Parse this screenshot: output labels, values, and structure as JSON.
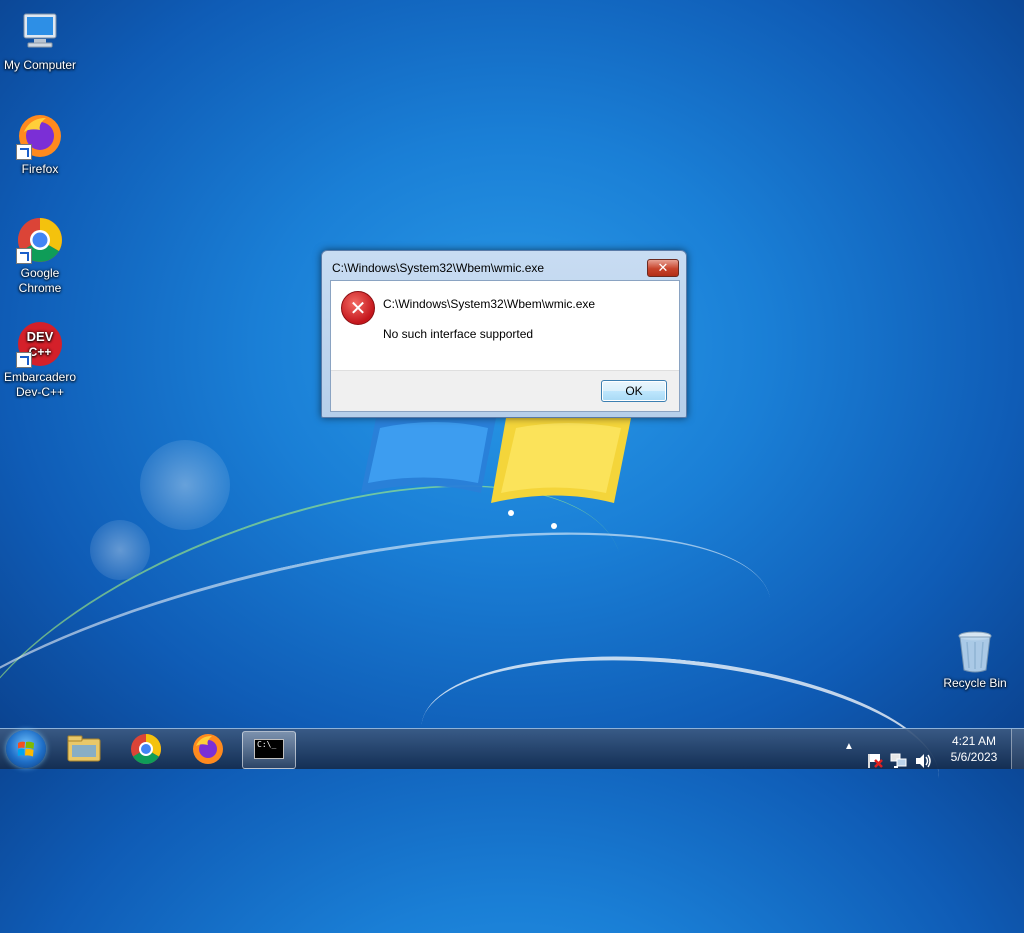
{
  "desktop": {
    "icons": [
      {
        "label": "My Computer"
      },
      {
        "label": "Firefox"
      },
      {
        "label": "Google Chrome"
      },
      {
        "label": "Embarcadero Dev-C++"
      },
      {
        "label": "Recycle Bin"
      }
    ]
  },
  "dialog": {
    "title": "C:\\Windows\\System32\\Wbem\\wmic.exe",
    "close_label": "✕",
    "message_path": "C:\\Windows\\System32\\Wbem\\wmic.exe",
    "message": "No such interface supported",
    "ok_label": "OK"
  },
  "taskbar": {
    "cmd_label": "C:\\_",
    "clock_time": "4:21 AM",
    "clock_date": "5/6/2023"
  },
  "icons": [
    "computer-icon",
    "firefox-icon",
    "chrome-icon",
    "devcpp-icon",
    "recycle-bin-icon",
    "error-icon",
    "start-icon",
    "explorer-icon",
    "cmd-icon",
    "network-icon",
    "volume-icon",
    "flag-icon"
  ]
}
